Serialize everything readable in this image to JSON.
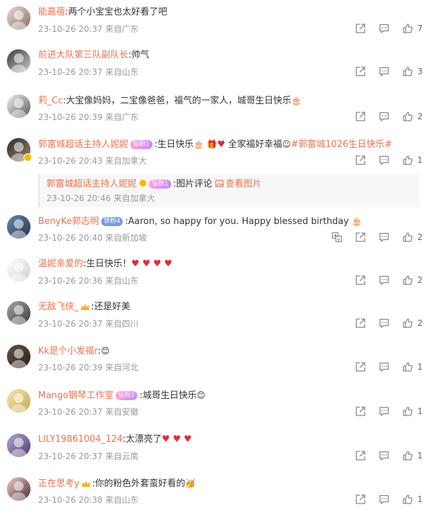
{
  "colors": {
    "name": "#eb7350",
    "meta": "#999999",
    "text": "#333333",
    "heart": "#e6283a"
  },
  "icons": [
    "share-icon",
    "comment-icon",
    "thumbs-up-icon",
    "translate-icon",
    "picture-icon"
  ],
  "comments": [
    {
      "name": "能嘉蓓",
      "text": ":两个小宝宝也太好看了吧",
      "time": "23-10-26 20:37",
      "location": "来自广东",
      "likes": "7"
    },
    {
      "name": "前进大队第三队副队长",
      "text": ":帅气",
      "time": "23-10-26 20:37",
      "location": "来自山东",
      "likes": "3"
    },
    {
      "name": "莉_Cc",
      "text": ":大宝像妈妈，二宝像爸爸，福气的一家人，城哥生日快乐",
      "time": "23-10-26 20:39",
      "location": "来自广东",
      "likes": "2"
    },
    {
      "name": "郭富城超话主持人妮妮",
      "badge": "钻粉1",
      "text": ":生日快乐",
      "text2": "全家福好幸福",
      "topic": "#郭富城1026生日快乐#",
      "time": "23-10-26 20:43",
      "location": "来自加拿大",
      "likes": "1",
      "reply": {
        "name": "郭富城超话主持人妮妮",
        "badge": "钻粉1",
        "text": ":图片评论",
        "link": "查看图片",
        "time": "23-10-26 20:46",
        "location": "来自加拿大"
      }
    },
    {
      "name": "BenyKe郭志明",
      "badge": "铁粉4",
      "text": ":Aaron, so happy for you. Happy blessed birthday",
      "time": "23-10-26 20:40",
      "location": "来自新加坡",
      "likes": "2"
    },
    {
      "name": "温妮亲爱的",
      "text": ":生日快乐！",
      "time": "23-10-26 20:36",
      "location": "来自山东",
      "likes": "2"
    },
    {
      "name": "无敌飞侠_",
      "text": ":还是好美",
      "time": "23-10-26 20:37",
      "location": "来自四川",
      "likes": "2"
    },
    {
      "name": "Kk是个小发福r",
      "text": ":",
      "time": "23-10-26 20:39",
      "location": "来自河北",
      "likes": "1"
    },
    {
      "name": "Mango钢琴工作室",
      "badge": "钻粉2",
      "text": ":城哥生日快乐",
      "time": "23-10-26 20:37",
      "location": "来自安徽",
      "likes": "1"
    },
    {
      "name": "LILY19861004_124",
      "text": ":太漂亮了",
      "time": "23-10-26 20:37",
      "location": "来自云南",
      "likes": "1"
    },
    {
      "name": "正在思考y",
      "text": ":你的粉色外套蛮好看的",
      "time": "23-10-26 20:38",
      "location": "来自山东",
      "likes": "1"
    }
  ]
}
